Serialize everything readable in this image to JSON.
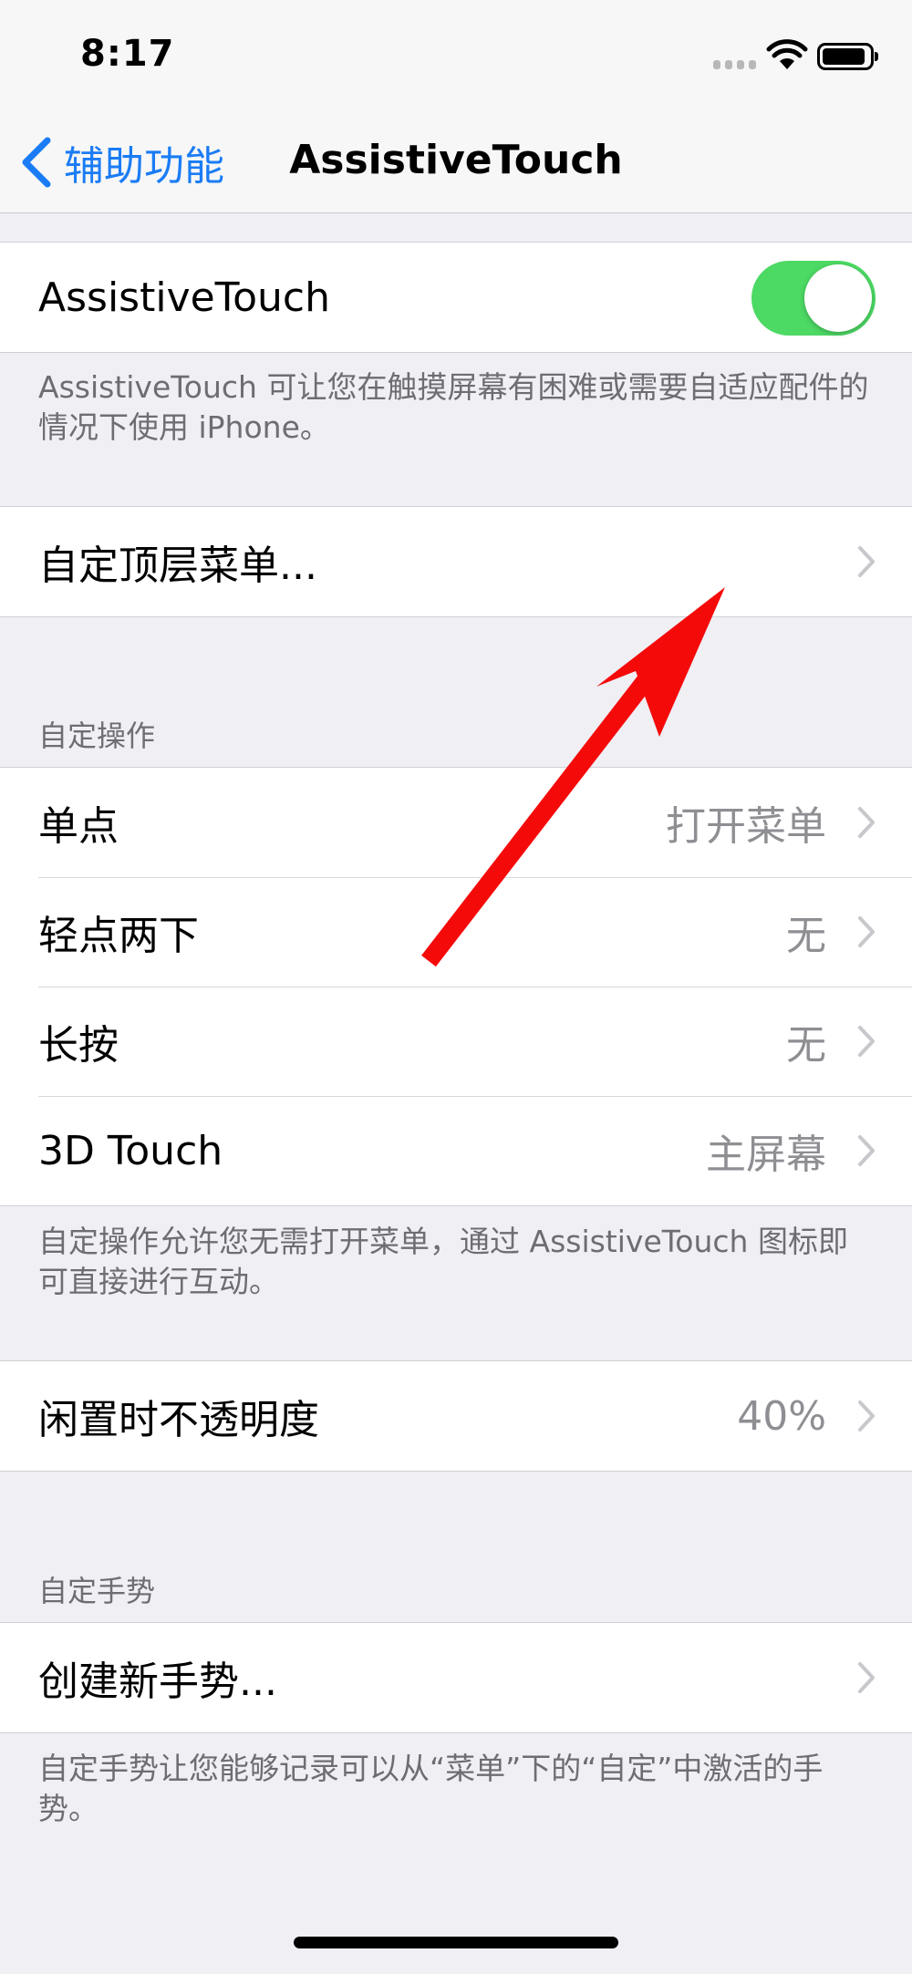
{
  "status_bar": {
    "time": "8:17"
  },
  "nav": {
    "back_label": "辅助功能",
    "title": "AssistiveTouch"
  },
  "main_toggle": {
    "label": "AssistiveTouch",
    "state": "on",
    "footer": "AssistiveTouch 可让您在触摸屏幕有困难或需要自适应配件的情况下使用 iPhone。"
  },
  "top_menu": {
    "label": "自定顶层菜单..."
  },
  "custom_actions": {
    "header": "自定操作",
    "rows": [
      {
        "label": "单点",
        "value": "打开菜单"
      },
      {
        "label": "轻点两下",
        "value": "无"
      },
      {
        "label": "长按",
        "value": "无"
      },
      {
        "label": "3D Touch",
        "value": "主屏幕"
      }
    ],
    "footer": "自定操作允许您无需打开菜单，通过 AssistiveTouch 图标即可直接进行互动。"
  },
  "idle_opacity": {
    "label": "闲置时不透明度",
    "value": "40%"
  },
  "custom_gestures": {
    "header": "自定手势",
    "create_label": "创建新手势...",
    "footer": "自定手势让您能够记录可以从“菜单”下的“自定”中激活的手势。"
  },
  "colors": {
    "accent": "#1a7cf5",
    "toggle_on": "#4cd964",
    "annotation": "#f50a0a"
  }
}
